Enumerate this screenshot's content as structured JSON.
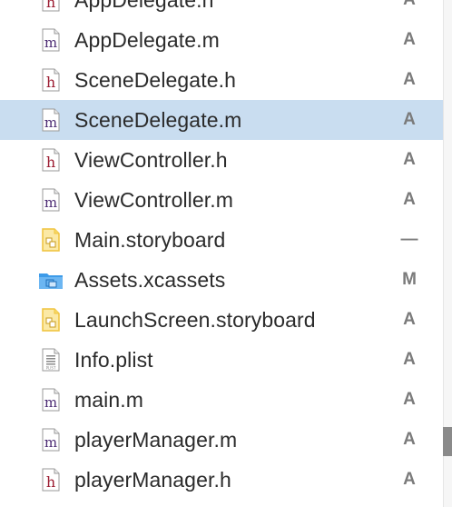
{
  "files": [
    {
      "name": "AppDelegate.h",
      "status": "A",
      "icon": "header-file-icon",
      "selected": false
    },
    {
      "name": "AppDelegate.m",
      "status": "A",
      "icon": "objc-source-file-icon",
      "selected": false
    },
    {
      "name": "SceneDelegate.h",
      "status": "A",
      "icon": "header-file-icon",
      "selected": false
    },
    {
      "name": "SceneDelegate.m",
      "status": "A",
      "icon": "objc-source-file-icon",
      "selected": true
    },
    {
      "name": "ViewController.h",
      "status": "A",
      "icon": "header-file-icon",
      "selected": false
    },
    {
      "name": "ViewController.m",
      "status": "A",
      "icon": "objc-source-file-icon",
      "selected": false
    },
    {
      "name": "Main.storyboard",
      "status": "—",
      "icon": "storyboard-file-icon",
      "selected": false
    },
    {
      "name": "Assets.xcassets",
      "status": "M",
      "icon": "asset-catalog-folder-icon",
      "selected": false
    },
    {
      "name": "LaunchScreen.storyboard",
      "status": "A",
      "icon": "storyboard-file-icon",
      "selected": false
    },
    {
      "name": "Info.plist",
      "status": "A",
      "icon": "plist-file-icon",
      "selected": false
    },
    {
      "name": "main.m",
      "status": "A",
      "icon": "objc-source-file-icon",
      "selected": false
    },
    {
      "name": "playerManager.m",
      "status": "A",
      "icon": "objc-source-file-icon",
      "selected": false
    },
    {
      "name": "playerManager.h",
      "status": "A",
      "icon": "header-file-icon",
      "selected": false
    }
  ],
  "colors": {
    "selection": "#c9ddf0",
    "text": "#2b2b2b",
    "status": "#7b7b7b",
    "header_letter": "#9b1c31",
    "source_letter": "#4b2a73",
    "storyboard": "#f0c33c",
    "folder": "#3d9be9"
  }
}
